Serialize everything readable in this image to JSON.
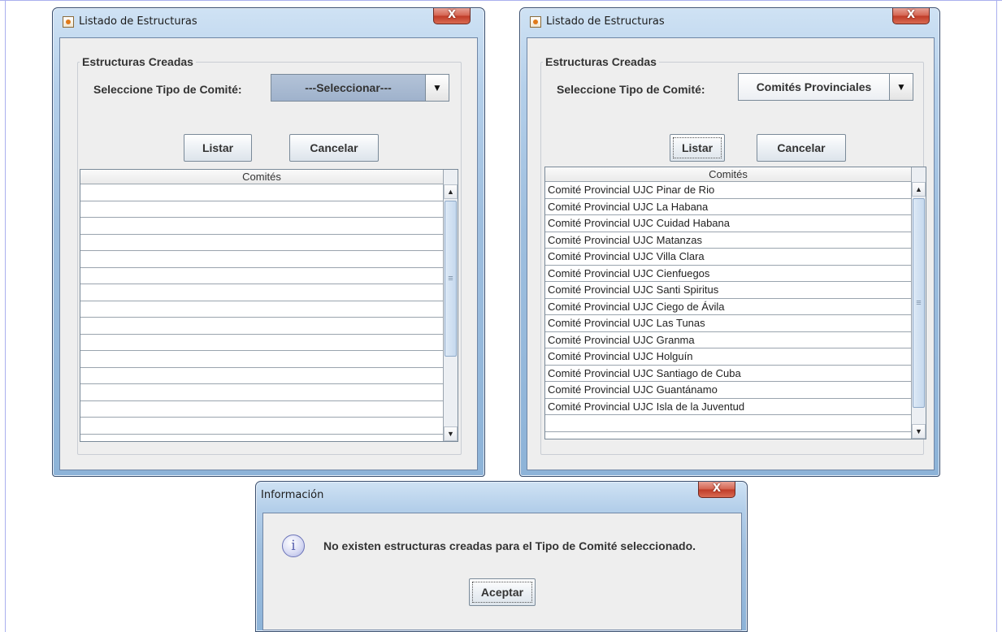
{
  "colors": {
    "titlebar": "#9fbfdf",
    "close_button": "#c8432e",
    "client_bg": "#eeeeee",
    "frame_line": "#aab0ee"
  },
  "icons": {
    "app": "java-cup-icon",
    "close": "close-x-icon",
    "info": "info-icon",
    "dropdown": "chevron-down-icon",
    "scroll_up": "arrow-up-icon",
    "scroll_down": "arrow-down-icon"
  },
  "window_left": {
    "title": "Listado de Estructuras",
    "close_label": "X",
    "group_title": "Estructuras Creadas",
    "type_label": "Seleccione Tipo de Comité:",
    "type_value": "---Seleccionar---",
    "dropdown_arrow": "▼",
    "list_button": "Listar",
    "cancel_button": "Cancelar",
    "table_header": "Comités",
    "rows": []
  },
  "window_right": {
    "title": "Listado de Estructuras",
    "close_label": "X",
    "group_title": "Estructuras Creadas",
    "type_label": "Seleccione Tipo de Comité:",
    "type_value": "Comités Provinciales",
    "dropdown_arrow": "▼",
    "list_button": "Listar",
    "cancel_button": "Cancelar",
    "table_header": "Comités",
    "rows": [
      "Comité Provincial UJC  Pinar de Rio",
      "Comité Provincial UJC La Habana",
      "Comité Provincial UJC Cuidad Habana",
      "Comité Provincial UJC  Matanzas",
      "Comité Provincial UJC Villa Clara",
      "Comité Provincial UJC Cienfuegos",
      "Comité Provincial UJC Santi Spiritus",
      "Comité Provincial UJC Ciego de Ávila",
      "Comité Provincial UJC Las Tunas",
      "Comité Provincial UJC Granma",
      "Comité Provincial UJC Holguín",
      "Comité Provincial UJC Santiago de Cuba",
      "Comité Provincial UJC Guantánamo",
      "Comité Provincial UJC Isla de la Juventud"
    ]
  },
  "dialog": {
    "title": "Información",
    "close_label": "X",
    "info_glyph": "i",
    "message": "No existen estructuras creadas para el Tipo de Comité seleccionado.",
    "ok_button": "Aceptar"
  }
}
